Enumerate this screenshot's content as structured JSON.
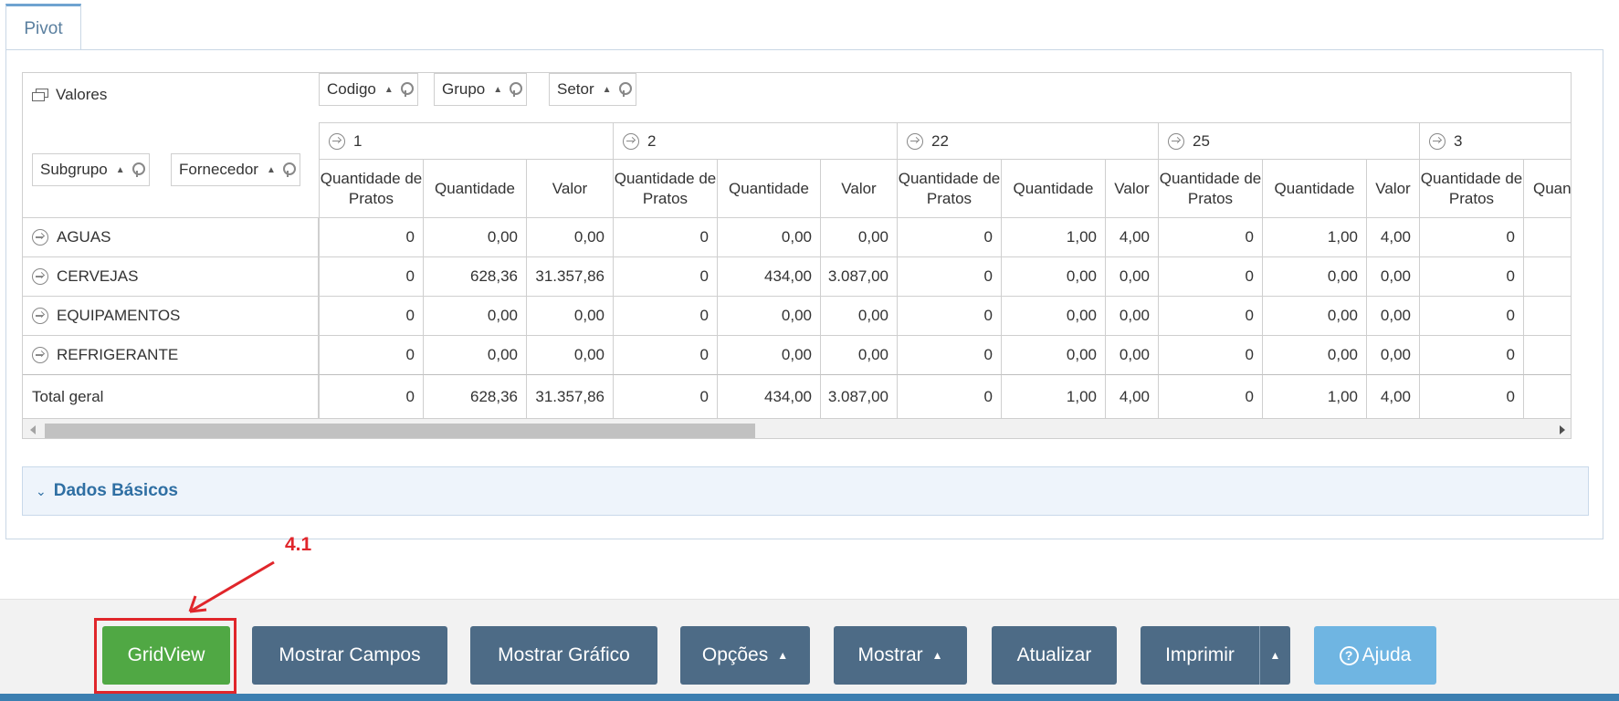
{
  "tab": {
    "label": "Pivot"
  },
  "pivot": {
    "data_area_label": "Valores",
    "column_fields": [
      {
        "label": "Codigo"
      },
      {
        "label": "Grupo"
      },
      {
        "label": "Setor"
      }
    ],
    "row_fields": [
      {
        "label": "Subgrupo"
      },
      {
        "label": "Fornecedor"
      }
    ],
    "column_groups": [
      "1",
      "2",
      "22",
      "25",
      "3"
    ],
    "measures": [
      "Quantidade de Pratos",
      "Quantidade",
      "Valor"
    ],
    "partial_measure": "Quan",
    "rows": [
      {
        "label": "AGUAS",
        "values": [
          "0",
          "0,00",
          "0,00",
          "0",
          "0,00",
          "0,00",
          "0",
          "1,00",
          "4,00",
          "0",
          "1,00",
          "4,00",
          "0"
        ]
      },
      {
        "label": "CERVEJAS",
        "values": [
          "0",
          "628,36",
          "31.357,86",
          "0",
          "434,00",
          "3.087,00",
          "0",
          "0,00",
          "0,00",
          "0",
          "0,00",
          "0,00",
          "0"
        ]
      },
      {
        "label": "EQUIPAMENTOS",
        "values": [
          "0",
          "0,00",
          "0,00",
          "0",
          "0,00",
          "0,00",
          "0",
          "0,00",
          "0,00",
          "0",
          "0,00",
          "0,00",
          "0"
        ]
      },
      {
        "label": "REFRIGERANTE",
        "values": [
          "0",
          "0,00",
          "0,00",
          "0",
          "0,00",
          "0,00",
          "0",
          "0,00",
          "0,00",
          "0",
          "0,00",
          "0,00",
          "0"
        ]
      }
    ],
    "total": {
      "label": "Total geral",
      "values": [
        "0",
        "628,36",
        "31.357,86",
        "0",
        "434,00",
        "3.087,00",
        "0",
        "1,00",
        "4,00",
        "0",
        "1,00",
        "4,00",
        "0"
      ]
    }
  },
  "dados_basicos": {
    "label": "Dados Básicos"
  },
  "annotation": {
    "label": "4.1",
    "color": "#e0262b"
  },
  "toolbar": {
    "gridview": "GridView",
    "mostrar_campos": "Mostrar Campos",
    "mostrar_grafico": "Mostrar Gráfico",
    "opcoes": "Opções",
    "mostrar": "Mostrar",
    "atualizar": "Atualizar",
    "imprimir": "Imprimir",
    "ajuda": "Ajuda"
  },
  "colors": {
    "primary_button": "#4d6b86",
    "gridview_button": "#50a844",
    "help_button": "#6fb5e2",
    "accent_bar": "#3c7fb1"
  }
}
